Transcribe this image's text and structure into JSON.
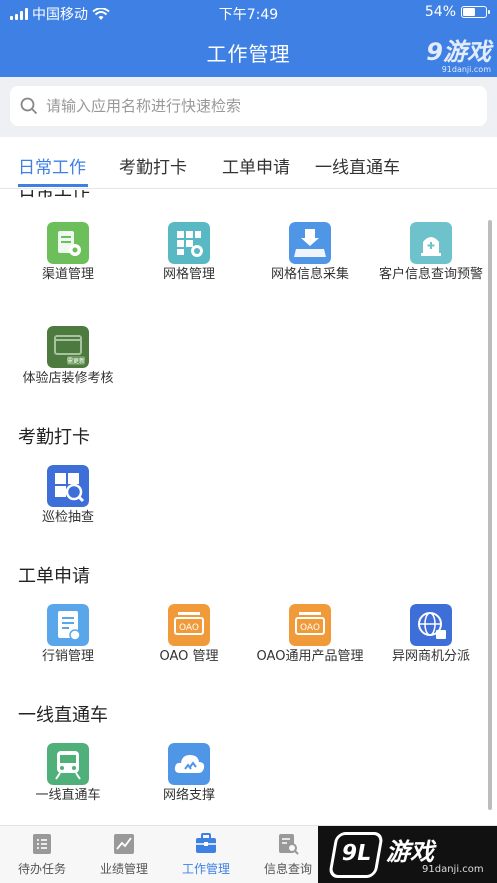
{
  "status_bar": {
    "carrier": "中国移动",
    "time": "下午7:49",
    "battery": "54%",
    "battery_level": 0.54
  },
  "header": {
    "title": "工作管理"
  },
  "watermark": {
    "top_logo": "9",
    "top_logo_text": "游戏",
    "top_url": "91danji.com",
    "bottom_text": "游戏",
    "bottom_logo": "9L",
    "bottom_url": "91danji.com"
  },
  "search": {
    "placeholder": "请输入应用名称进行快速检索",
    "value": ""
  },
  "tabs": [
    {
      "label": "日常工作",
      "active": true
    },
    {
      "label": "考勤打卡",
      "active": false
    },
    {
      "label": "工单申请",
      "active": false
    },
    {
      "label": "一线直通车",
      "active": false
    }
  ],
  "sections": [
    {
      "title": "日常工作",
      "items": [
        {
          "label": "渠道管理",
          "icon": "channel-icon"
        },
        {
          "label": "网格管理",
          "icon": "grid-icon"
        },
        {
          "label": "网格信息采集",
          "icon": "grid-info-icon"
        },
        {
          "label": "客户信息查询预警",
          "icon": "customer-alert-icon"
        },
        {
          "label": "体验店装修考核",
          "icon": "store-icon",
          "badge": "需更新"
        }
      ]
    },
    {
      "title": "考勤打卡",
      "items": [
        {
          "label": "巡检抽查",
          "icon": "inspection-icon"
        }
      ]
    },
    {
      "title": "工单申请",
      "items": [
        {
          "label": "行销管理",
          "icon": "document-icon"
        },
        {
          "label": "OAO 管理",
          "icon": "oao-icon",
          "icon_text": "OAO"
        },
        {
          "label": "OAO通用产品管理",
          "icon": "oao-product-icon",
          "icon_text": "OAO"
        },
        {
          "label": "异网商机分派",
          "icon": "globe-icon"
        }
      ]
    },
    {
      "title": "一线直通车",
      "items": [
        {
          "label": "一线直通车",
          "icon": "train-icon"
        },
        {
          "label": "网络支撑",
          "icon": "cloud-icon"
        }
      ]
    }
  ],
  "tabbar": [
    {
      "label": "待办任务",
      "icon": "todo-icon",
      "active": false
    },
    {
      "label": "业绩管理",
      "icon": "chart-icon",
      "active": false
    },
    {
      "label": "工作管理",
      "icon": "briefcase-icon",
      "active": true
    },
    {
      "label": "信息查询",
      "icon": "search-doc-icon",
      "active": false
    }
  ],
  "colors": {
    "primary": "#3f80e4",
    "green": "#6cbf5a",
    "teal": "#58b8c4",
    "blue": "#4f96e6",
    "orange": "#f09a3a",
    "dark_green": "#4d7a3e",
    "navy": "#3e6fd8"
  }
}
